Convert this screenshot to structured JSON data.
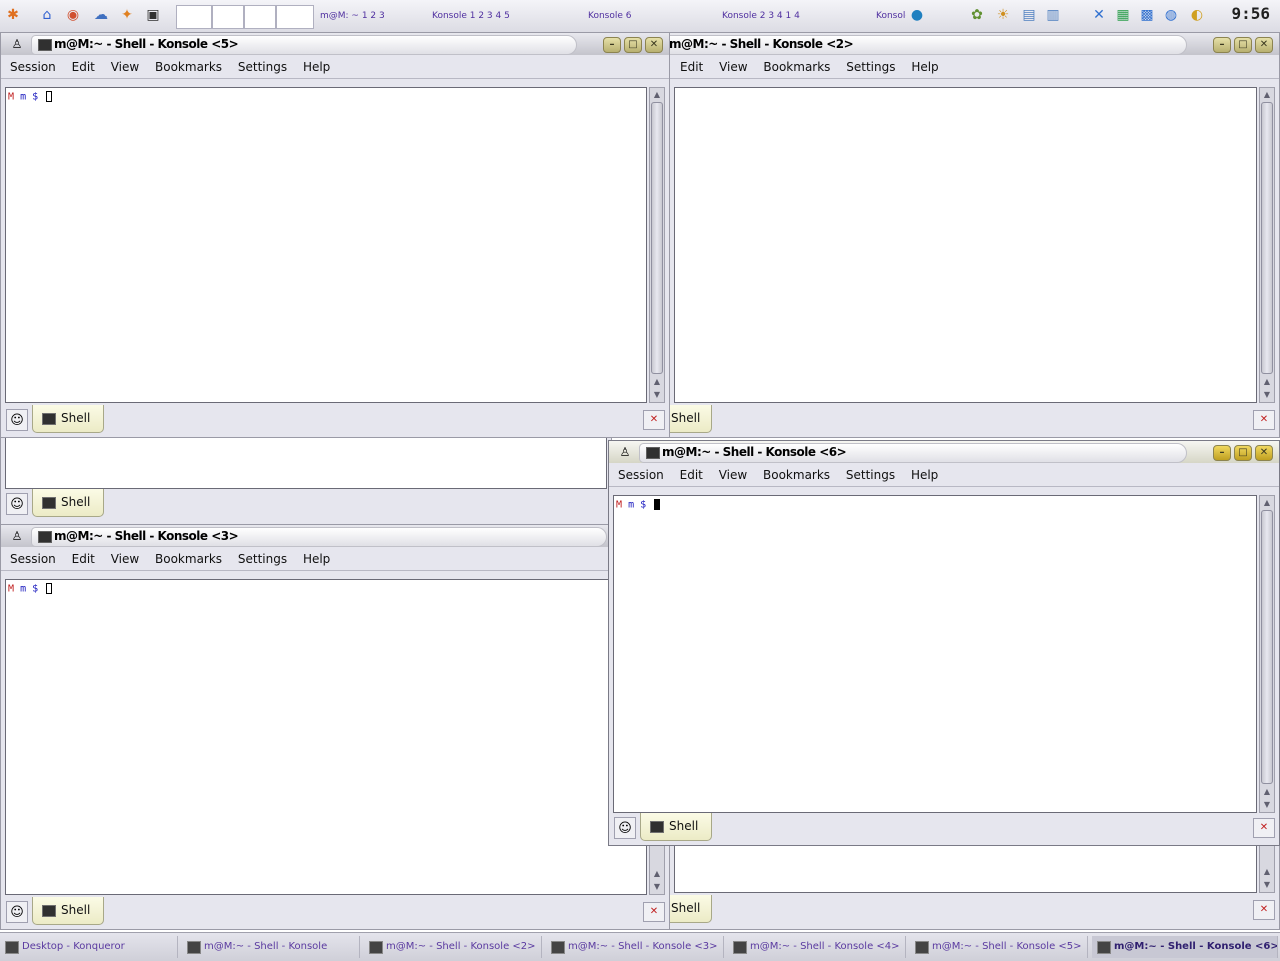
{
  "panel": {
    "clock": "9:56",
    "task_labels": [
      "m@M: ~ 1 2 3",
      "Konsole 1 2 3 4 5",
      "Konsole 6",
      "Konsole 2 3 4 1 4",
      "Konsole"
    ]
  },
  "menu": [
    "Session",
    "Edit",
    "View",
    "Bookmarks",
    "Settings",
    "Help"
  ],
  "prompt": {
    "host": "M",
    "user": "m",
    "dollar": "$"
  },
  "tab": {
    "label": "Shell"
  },
  "windows": {
    "k5": {
      "title": "m@M:~ - Shell - Konsole <5>"
    },
    "k2": {
      "title": "m@M:~ - Shell - Konsole <2>"
    },
    "k3": {
      "title": "m@M:~ - Shell - Konsole <3>"
    },
    "k6": {
      "title": "m@M:~ - Shell - Konsole <6>"
    }
  },
  "taskbar": [
    "Desktop - Konqueror",
    "m@M:~ - Shell - Konsole",
    "m@M:~ - Shell - Konsole <2>",
    "m@M:~ - Shell - Konsole <3>",
    "m@M:~ - Shell - Konsole <4>",
    "m@M:~ - Shell - Konsole <5>",
    "m@M:~ - Shell - Konsole <6>"
  ]
}
